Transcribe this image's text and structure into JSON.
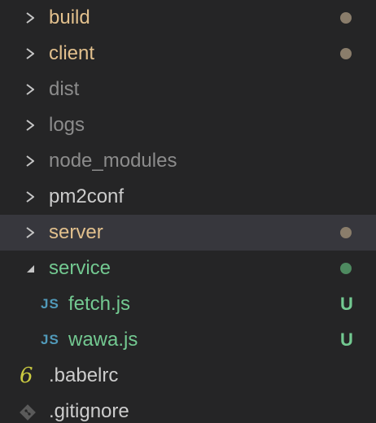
{
  "colors": {
    "background": "#252526",
    "selected_row": "#37373d",
    "twistie": "#c5c5c5",
    "modified_text": "#e2c08d",
    "untracked_text": "#73c991",
    "plain_text": "#cccccc",
    "ignored_text": "#8c8c8c",
    "modified_dot": "#8a7d6b",
    "untracked_dot": "#4e8a60",
    "js_icon": "#519aba",
    "babel_icon": "#cbcb41",
    "git_icon": "#5a5a5a"
  },
  "tree": {
    "rows": [
      {
        "label": "build",
        "kind": "folder",
        "expanded": false,
        "status": "modified"
      },
      {
        "label": "client",
        "kind": "folder",
        "expanded": false,
        "status": "modified"
      },
      {
        "label": "dist",
        "kind": "folder",
        "expanded": false,
        "status": "ignored"
      },
      {
        "label": "logs",
        "kind": "folder",
        "expanded": false,
        "status": "ignored"
      },
      {
        "label": "node_modules",
        "kind": "folder",
        "expanded": false,
        "status": "ignored"
      },
      {
        "label": "pm2conf",
        "kind": "folder",
        "expanded": false,
        "status": "plain"
      },
      {
        "label": "server",
        "kind": "folder",
        "expanded": false,
        "status": "modified",
        "selected": true
      },
      {
        "label": "service",
        "kind": "folder",
        "expanded": true,
        "status": "untracked"
      },
      {
        "label": "fetch.js",
        "kind": "file",
        "icon_text": "JS",
        "status": "untracked",
        "badge": "U"
      },
      {
        "label": "wawa.js",
        "kind": "file",
        "icon_text": "JS",
        "status": "untracked",
        "badge": "U"
      },
      {
        "label": ".babelrc",
        "kind": "root-file",
        "icon": "babel-icon",
        "icon_text": "6",
        "status": "plain"
      },
      {
        "label": ".gitignore",
        "kind": "root-file",
        "icon": "git-icon",
        "status": "plain"
      }
    ]
  }
}
